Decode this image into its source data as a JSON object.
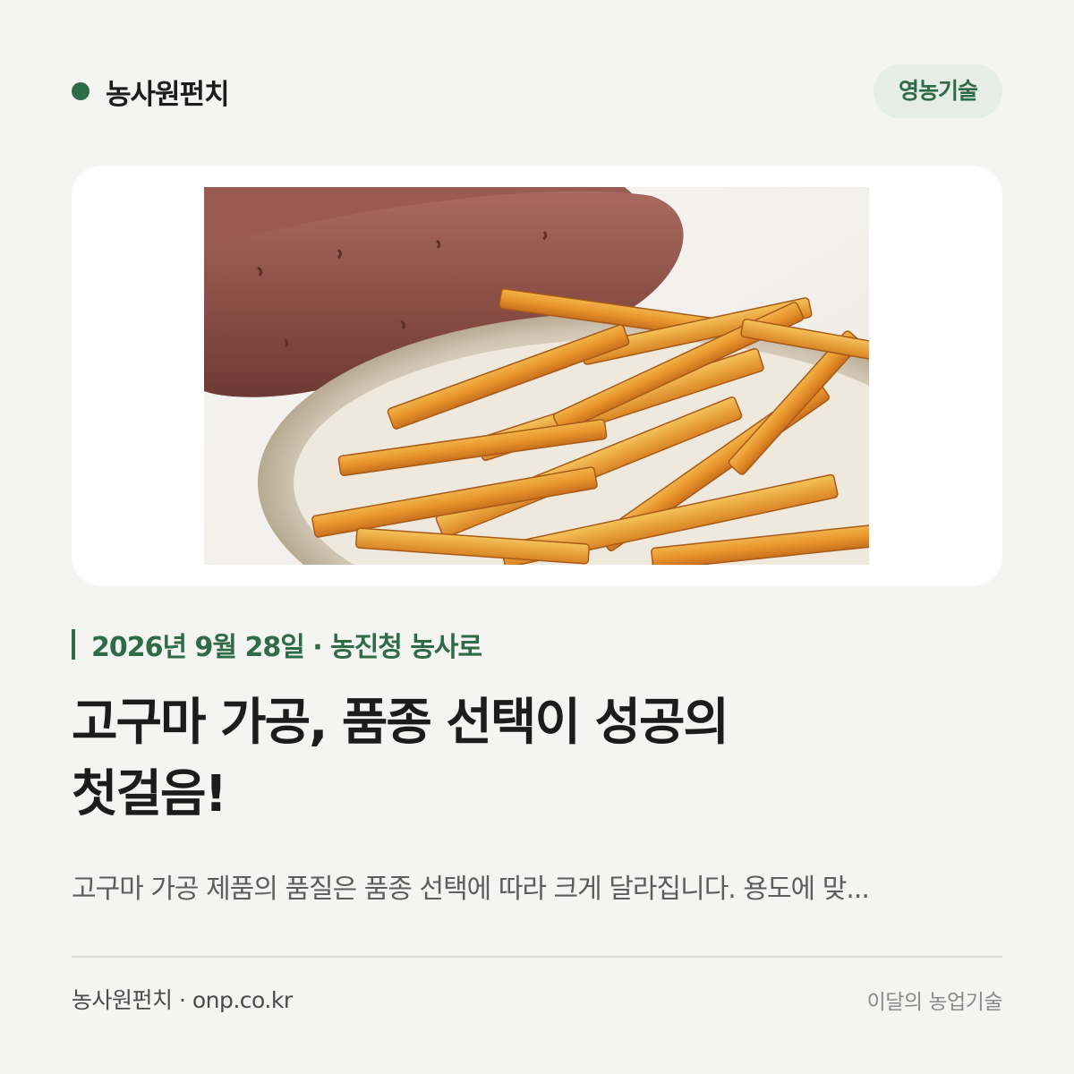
{
  "header": {
    "brand_name": "농사원펀치",
    "category_badge": "영농기술",
    "brand_color": "#2e6b47"
  },
  "hero_image": {
    "alt": "고구마 가공",
    "icon": "sweet-potato-fries-photo"
  },
  "article": {
    "meta": "2026년 9월 28일 · 농진청 농사로",
    "headline_line1": "고구마 가공, 품종 선택이 성공의",
    "headline_line2": "첫걸음!",
    "summary": "고구마 가공 제품의 품질은 품종 선택에 따라 크게 달라집니다. 용도에 맞..."
  },
  "footer": {
    "source": "농사원펀치 · onp.co.kr",
    "section": "이달의 농업기술"
  }
}
